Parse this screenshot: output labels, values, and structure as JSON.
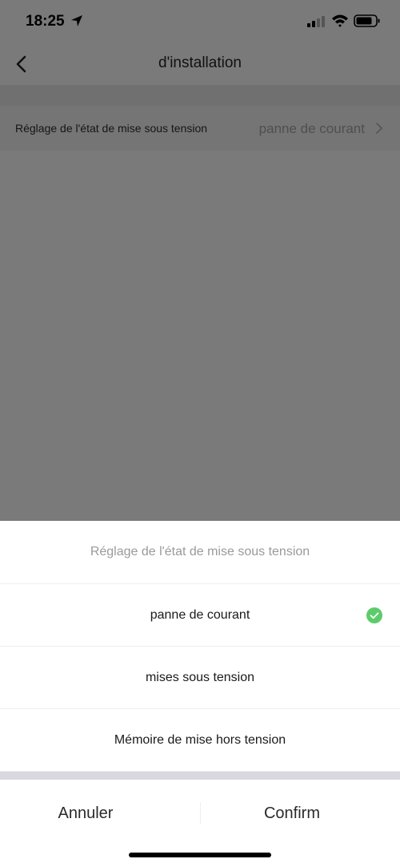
{
  "status_bar": {
    "time": "18:25"
  },
  "nav": {
    "title": "d'installation"
  },
  "settings": {
    "row_label": "Réglage de l'état de mise sous tension",
    "row_value": "panne de courant"
  },
  "sheet": {
    "title": "Réglage de l'état de mise sous tension",
    "options": [
      {
        "label": "panne de courant",
        "selected": true
      },
      {
        "label": "mises sous tension",
        "selected": false
      },
      {
        "label": "Mémoire de mise hors tension",
        "selected": false
      }
    ],
    "cancel_label": "Annuler",
    "confirm_label": "Confirm"
  },
  "colors": {
    "check_green": "#5ccc6b",
    "overlay": "#7a7a7a"
  }
}
